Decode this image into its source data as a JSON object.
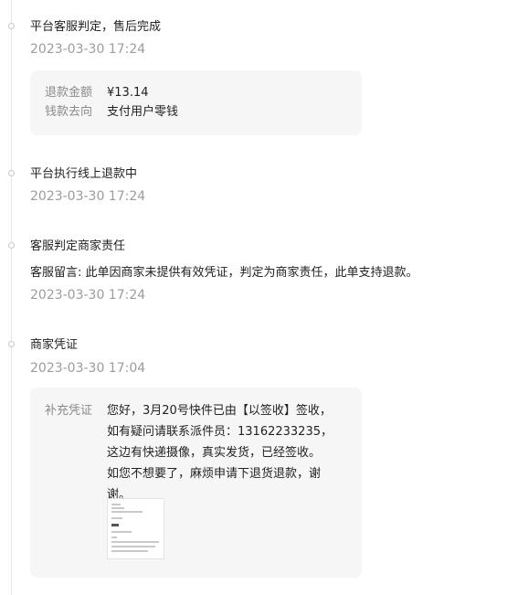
{
  "timeline": {
    "event1": {
      "title": "平台客服判定，售后完成",
      "time": "2023-03-30 17:24",
      "refund_amount_label": "退款金额",
      "refund_amount_value": "¥13.14",
      "refund_destination_label": "钱款去向",
      "refund_destination_value": "支付用户零钱"
    },
    "event2": {
      "title": "平台执行线上退款中",
      "time": "2023-03-30 17:24"
    },
    "event3": {
      "title": "客服判定商家责任",
      "message": "客服留言: 此单因商家未提供有效凭证，判定为商家责任，此单支持退款。",
      "time": "2023-03-30 17:24"
    },
    "event4": {
      "title": "商家凭证",
      "time": "2023-03-30 17:04",
      "evidence_label": "补充凭证",
      "evidence_text": "您好，3月20号快件已由【以签收】签收，\n如有疑问请联系派件员：13162233235，\n这边有快递摄像，真实发货，已经签收。\n如您不想要了，麻烦申请下退货退款，谢\n谢。"
    }
  }
}
